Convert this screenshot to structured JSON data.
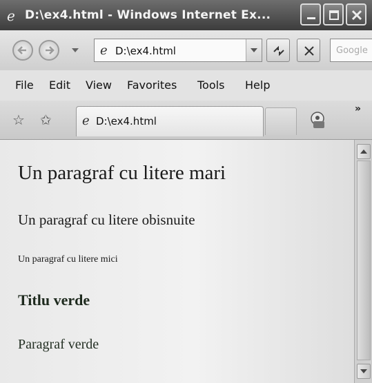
{
  "window": {
    "title": "D:\\ex4.html - Windows Internet Ex...",
    "icon": "ie-logo-icon",
    "controls": [
      "minimize-icon",
      "maximize-icon",
      "close-icon"
    ]
  },
  "address_bar": {
    "url": "D:\\ex4.html",
    "search_placeholder": "Google"
  },
  "menu": {
    "file": "File",
    "edit": "Edit",
    "view": "View",
    "favorites": "Favorites",
    "tools": "Tools",
    "help": "Help"
  },
  "tabs": {
    "active_label": "D:\\ex4.html",
    "overflow": "»"
  },
  "page": {
    "para_large": "Un paragraf cu litere mari",
    "para_normal": "Un paragraf cu litere obisnuite",
    "para_small": "Un paragraf cu litere mici",
    "heading_green": "Titlu verde",
    "para_green": "Paragraf verde"
  }
}
